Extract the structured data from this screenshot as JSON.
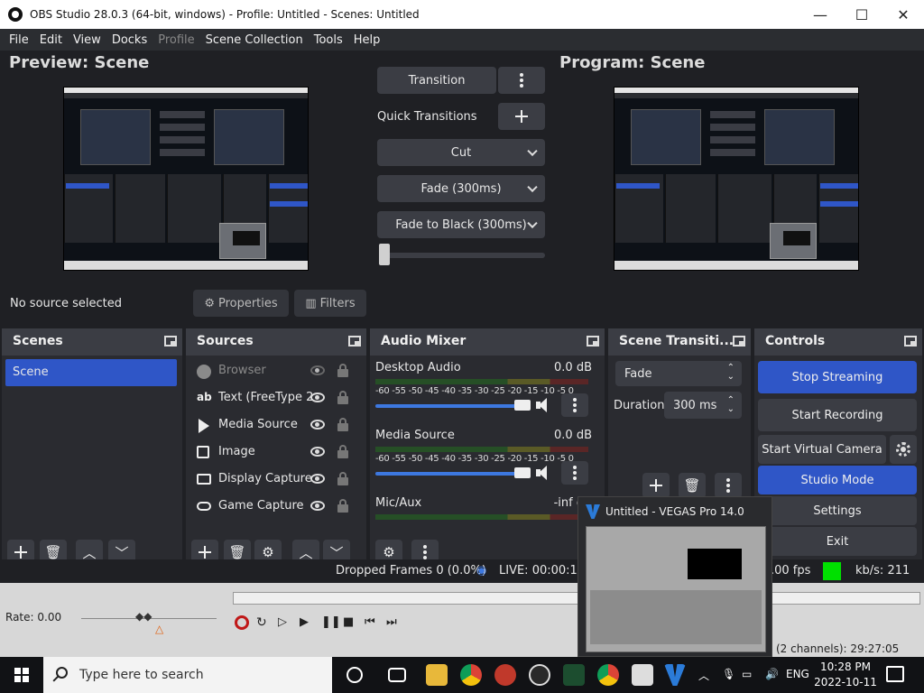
{
  "window": {
    "title": "OBS Studio 28.0.3 (64-bit, windows) - Profile: Untitled - Scenes: Untitled",
    "minimize": "—",
    "maximize": "☐",
    "close": "✕"
  },
  "menu": [
    "File",
    "Edit",
    "View",
    "Docks",
    "Profile",
    "Scene Collection",
    "Tools",
    "Help"
  ],
  "preview": {
    "title": "Preview: Scene"
  },
  "program": {
    "title": "Program: Scene"
  },
  "transition": {
    "button_label": "Transition",
    "quick_transitions_label": "Quick Transitions",
    "cut_label": "Cut",
    "fade_label": "Fade (300ms)",
    "fade_black_label": "Fade to Black (300ms)",
    "tbar_position": 0
  },
  "source_bar": {
    "status": "No source selected",
    "properties_label": "Properties",
    "filters_label": "Filters"
  },
  "scenes": {
    "title": "Scenes",
    "items": [
      "Scene"
    ]
  },
  "sources": {
    "title": "Sources",
    "items": [
      {
        "name": "Browser",
        "icon": "globe-icon",
        "visible": false
      },
      {
        "name": "Text (FreeType 2",
        "icon": "text-icon",
        "visible": true
      },
      {
        "name": "Media Source",
        "icon": "play-icon",
        "visible": true
      },
      {
        "name": "Image",
        "icon": "image-icon",
        "visible": true
      },
      {
        "name": "Display Capture",
        "icon": "monitor-icon",
        "visible": true
      },
      {
        "name": "Game Capture",
        "icon": "gamepad-icon",
        "visible": true
      }
    ]
  },
  "mixer": {
    "title": "Audio Mixer",
    "channels": [
      {
        "name": "Desktop Audio",
        "db": "0.0 dB",
        "level": 0.92
      },
      {
        "name": "Media Source",
        "db": "0.0 dB",
        "level": 0.92
      },
      {
        "name": "Mic/Aux",
        "db": "-inf dB",
        "level": 0.92
      }
    ],
    "scale": "-60 -55 -50 -45 -40 -35 -30 -25 -20 -15 -10 -5 0"
  },
  "scene_transitions": {
    "title": "Scene Transiti...",
    "selected": "Fade",
    "duration_label": "Duration",
    "duration_value": "300 ms"
  },
  "controls": {
    "title": "Controls",
    "stop_streaming": "Stop Streaming",
    "start_recording": "Start Recording",
    "start_virtual_camera": "Start Virtual Camera",
    "studio_mode": "Studio Mode",
    "settings": "Settings",
    "exit": "Exit"
  },
  "status": {
    "dropped_frames": "Dropped Frames 0 (0.0%)",
    "live": "LIVE: 00:00:11",
    "fps": ".00 fps",
    "bitrate": "kb/s: 211",
    "status_color": "#00e000"
  },
  "vegas": {
    "rate": "Rate: 0.00",
    "channels_info": "(2 channels): 29:27:05",
    "popup_title": "Untitled - VEGAS Pro 14.0"
  },
  "taskbar": {
    "search_placeholder": "Type here to search",
    "language": "ENG",
    "time": "10:28 PM",
    "date": "2022-10-11"
  },
  "colors": {
    "accent_blue": "#2f56c7",
    "panel": "#2a2b30",
    "header": "#3b3d44"
  }
}
